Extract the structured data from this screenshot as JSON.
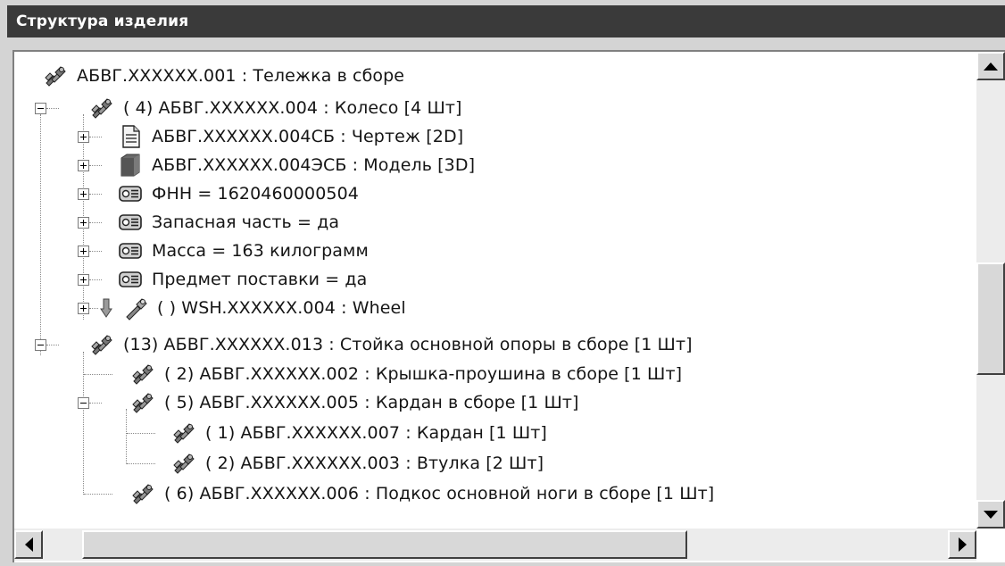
{
  "window": {
    "title": "Структура изделия"
  },
  "tree": {
    "root": {
      "label": "АБВГ.XXXXXX.001 : Тележка в сборе",
      "icon": "assembly-icon"
    },
    "wheel_assembly": {
      "label": "( 4) АБВГ.XXXXXX.004 : Колесо [4 Шт]",
      "icon": "assembly-icon"
    },
    "drawing": {
      "label": "АБВГ.XXXXXX.004СБ : Чертеж [2D]",
      "icon": "document-icon"
    },
    "model": {
      "label": "АБВГ.XXXXXX.004ЭСБ : Модель [3D]",
      "icon": "cube-icon"
    },
    "fnn": {
      "label": "ФНН = 1620460000504",
      "icon": "attribute-icon"
    },
    "spare": {
      "label": "Запасная часть = да",
      "icon": "attribute-icon"
    },
    "mass": {
      "label": "Масса = 163 килограмм",
      "icon": "attribute-icon"
    },
    "delivery": {
      "label": "Предмет поставки = да",
      "icon": "attribute-icon"
    },
    "wheel_link": {
      "label": "( ) WSH.XXXXXX.004 : Wheel",
      "icon": "part-icon"
    },
    "strut": {
      "label": "(13) АБВГ.XXXXXX.013 : Стойка основной опоры в сборе [1 Шт]",
      "icon": "assembly-icon"
    },
    "cover": {
      "label": "( 2) АБВГ.XXXXXX.002 : Крышка-проушина в сборе [1 Шт]",
      "icon": "assembly-icon"
    },
    "cardan_assembly": {
      "label": "( 5) АБВГ.XXXXXX.005 : Кардан в сборе [1 Шт]",
      "icon": "assembly-icon"
    },
    "cardan": {
      "label": "( 1) АБВГ.XXXXXX.007 : Кардан [1 Шт]",
      "icon": "assembly-icon"
    },
    "bushing": {
      "label": "( 2) АБВГ.XXXXXX.003 : Втулка [2 Шт]",
      "icon": "assembly-icon"
    },
    "brace": {
      "label": "( 6) АБВГ.XXXXXX.006 : Подкос основной ноги в сборе [1 Шт]",
      "icon": "assembly-icon"
    }
  },
  "colors": {
    "titlebar": "#3a3a3a",
    "title_text": "#ffffff",
    "frame": "#d4d4d4",
    "tree_bg": "#ffffff"
  }
}
